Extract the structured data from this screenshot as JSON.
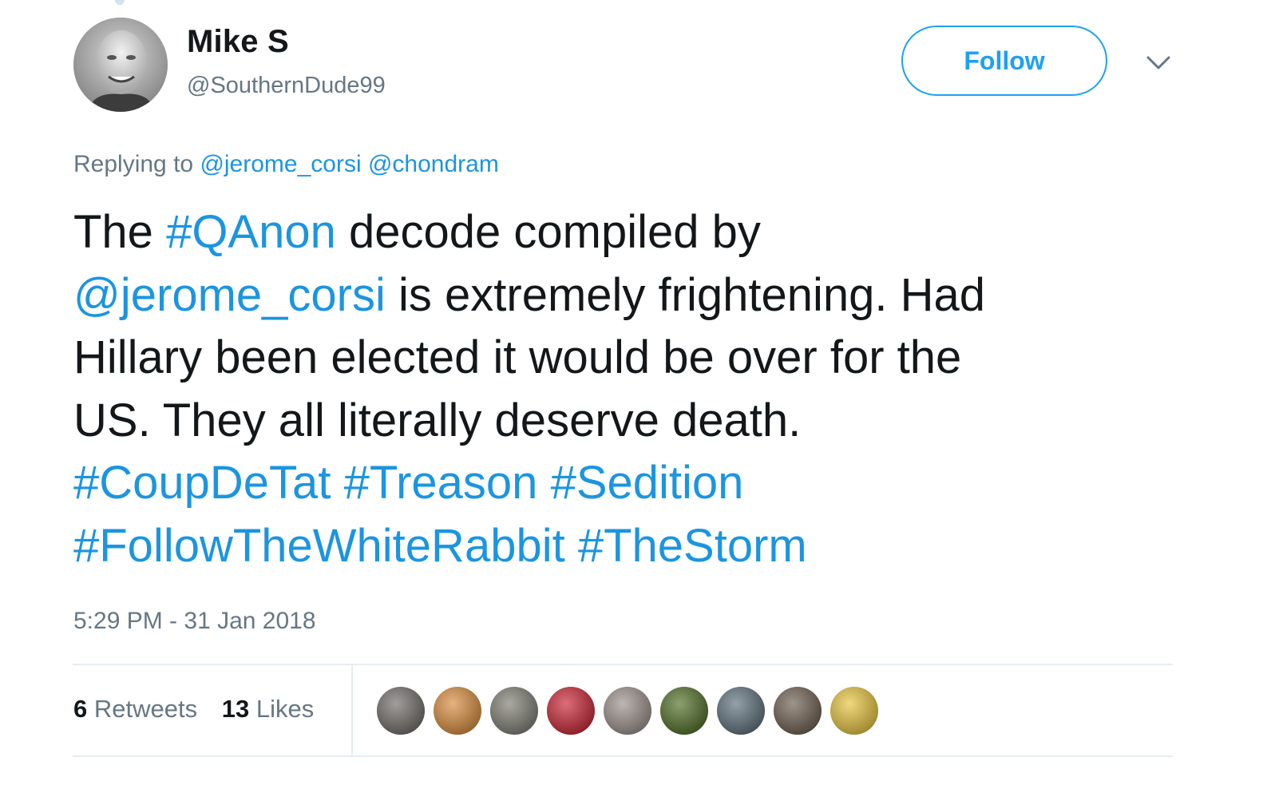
{
  "author": {
    "display_name": "Mike S",
    "handle": "@SouthernDude99"
  },
  "follow_button": {
    "label": "Follow"
  },
  "replying": {
    "prefix": "Replying to",
    "mentions": [
      "@jerome_corsi",
      "@chondram"
    ]
  },
  "tweet": {
    "lines": [
      [
        {
          "t": "The ",
          "link": false
        },
        {
          "t": "#QAnon",
          "link": true
        },
        {
          "t": " decode compiled by",
          "link": false
        }
      ],
      [
        {
          "t": "@jerome_corsi",
          "link": true
        },
        {
          "t": " is extremely frightening.  Had",
          "link": false
        }
      ],
      [
        {
          "t": "Hillary been elected it would be over for the",
          "link": false
        }
      ],
      [
        {
          "t": "US.  They all literally deserve death.",
          "link": false
        }
      ],
      [
        {
          "t": "#CoupDeTat",
          "link": true
        },
        {
          "t": " ",
          "link": false
        },
        {
          "t": "#Treason",
          "link": true
        },
        {
          "t": " ",
          "link": false
        },
        {
          "t": "#Sedition",
          "link": true
        }
      ],
      [
        {
          "t": "#FollowTheWhiteRabbit",
          "link": true
        },
        {
          "t": " ",
          "link": false
        },
        {
          "t": "#TheStorm",
          "link": true
        }
      ]
    ]
  },
  "timestamp": "5:29 PM - 31 Jan 2018",
  "stats": {
    "retweets_count": "6",
    "retweets_label": "Retweets",
    "likes_count": "13",
    "likes_label": "Likes"
  },
  "likers": [
    {
      "icon": "avatar-photo-cat",
      "color": "#6e6a66"
    },
    {
      "icon": "avatar-constitution-parchment",
      "color": "#d98a3a"
    },
    {
      "icon": "avatar-emblem-seal",
      "color": "#7c7c72"
    },
    {
      "icon": "avatar-lion-logo",
      "color": "#c8202f"
    },
    {
      "icon": "avatar-cross-flag",
      "color": "#9a8f8a"
    },
    {
      "icon": "avatar-foliage",
      "color": "#4d6b22"
    },
    {
      "icon": "avatar-animal-photo",
      "color": "#5b6e7a"
    },
    {
      "icon": "avatar-dark-photo",
      "color": "#6a5b4c"
    },
    {
      "icon": "avatar-person-yellow",
      "color": "#e7c43a"
    }
  ],
  "colors": {
    "accent": "#1b95e0",
    "follow_border": "#1da1f2",
    "text_primary": "#14171a",
    "text_secondary": "#657786",
    "divider": "#e6ecf0"
  }
}
